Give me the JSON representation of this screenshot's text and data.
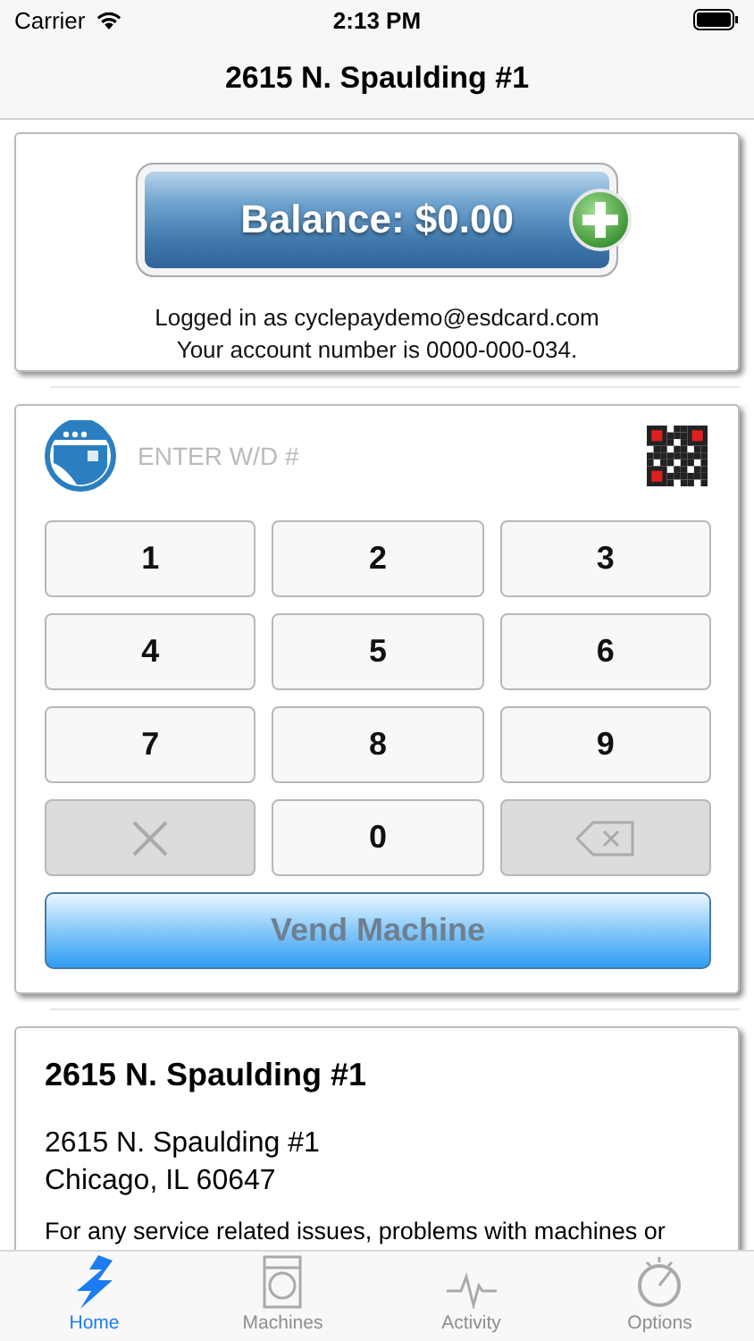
{
  "status_bar": {
    "carrier": "Carrier",
    "time": "2:13 PM"
  },
  "nav": {
    "title": "2615 N. Spaulding #1"
  },
  "account": {
    "balance": "Balance: $0.00",
    "logged_in": "Logged in as cyclepaydemo@esdcard.com",
    "account_number": "Your account number is 0000-000-034."
  },
  "vend": {
    "placeholder": "ENTER W/D #",
    "keys": [
      {
        "kind": "digit",
        "label": "1",
        "disabled": false
      },
      {
        "kind": "digit",
        "label": "2",
        "disabled": false
      },
      {
        "kind": "digit",
        "label": "3",
        "disabled": false
      },
      {
        "kind": "digit",
        "label": "4",
        "disabled": false
      },
      {
        "kind": "digit",
        "label": "5",
        "disabled": false
      },
      {
        "kind": "digit",
        "label": "6",
        "disabled": false
      },
      {
        "kind": "digit",
        "label": "7",
        "disabled": false
      },
      {
        "kind": "digit",
        "label": "8",
        "disabled": false
      },
      {
        "kind": "digit",
        "label": "9",
        "disabled": false
      },
      {
        "kind": "clear",
        "disabled": true
      },
      {
        "kind": "digit",
        "label": "0",
        "disabled": false
      },
      {
        "kind": "backspace",
        "disabled": true
      }
    ],
    "button": {
      "label": "Vend Machine",
      "disabled": true
    }
  },
  "location": {
    "name": "2615 N. Spaulding #1",
    "address_line_1": "2615 N. Spaulding #1",
    "address_line_2": "Chicago, IL 60647",
    "note": "For any service related issues, problems with machines or"
  },
  "tabs": [
    {
      "kind": "home",
      "label": "Home",
      "selected": true
    },
    {
      "kind": "machines",
      "label": "Machines",
      "selected": false
    },
    {
      "kind": "activity",
      "label": "Activity",
      "selected": false
    },
    {
      "kind": "options",
      "label": "Options",
      "selected": false
    }
  ]
}
